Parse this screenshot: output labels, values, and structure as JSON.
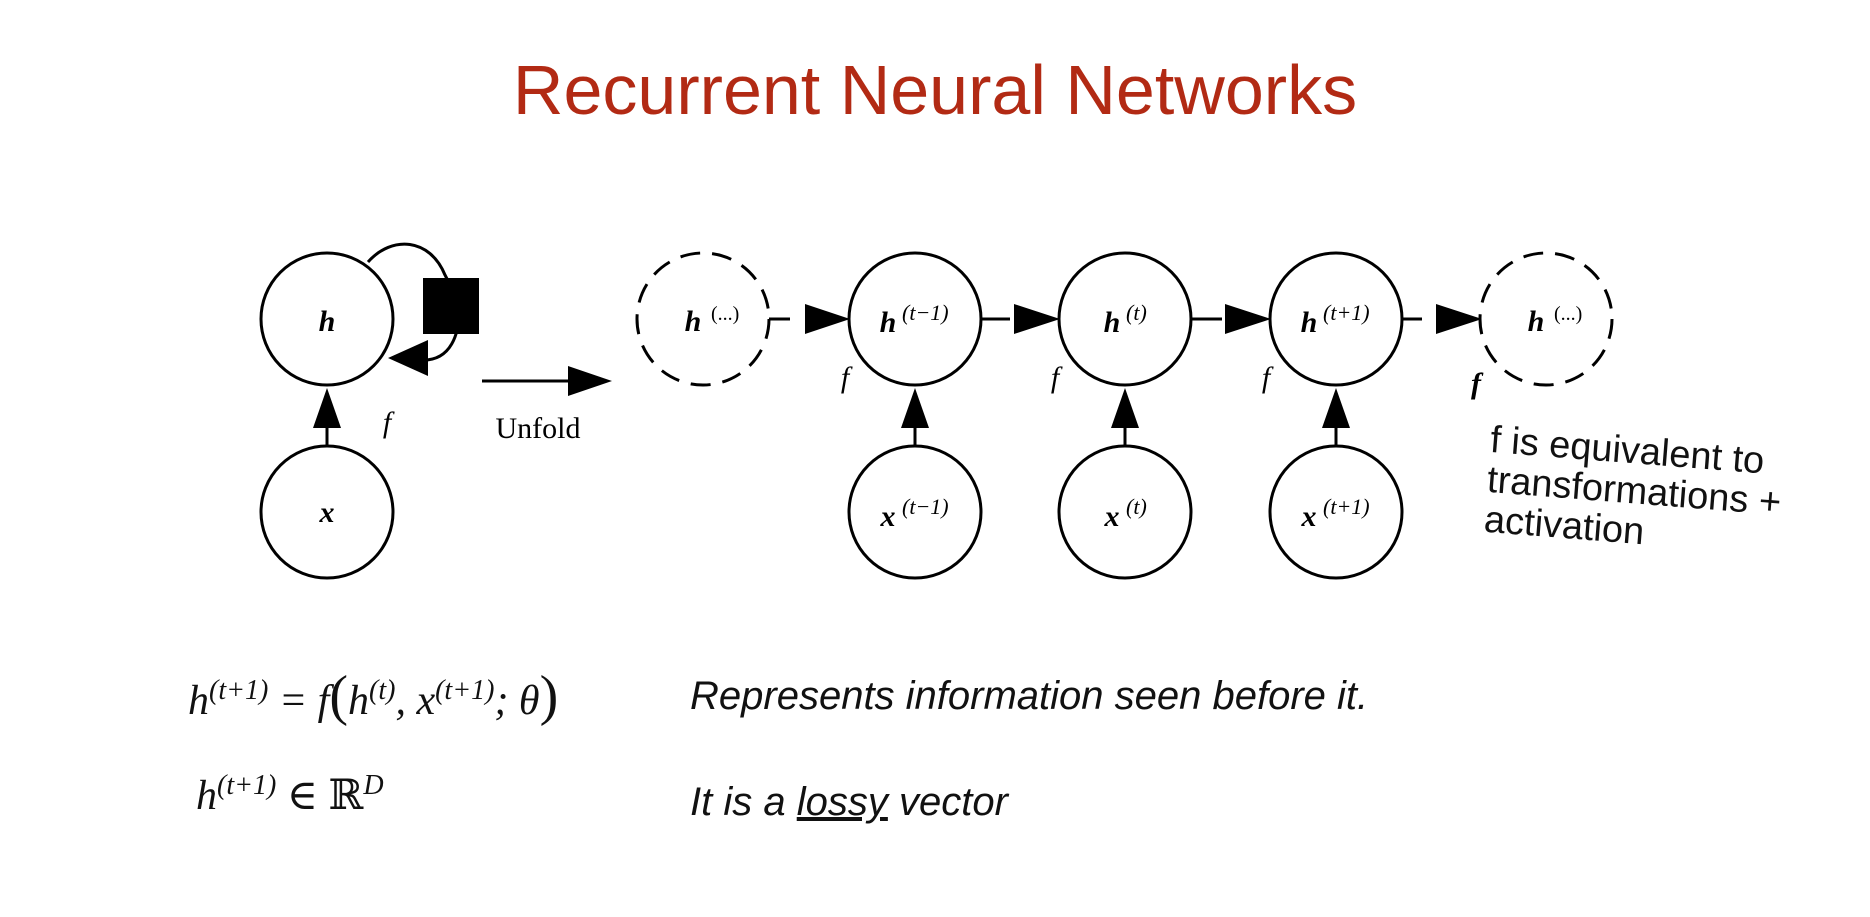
{
  "title": "Recurrent Neural Networks",
  "diagram": {
    "folded": {
      "h_node": "h",
      "x_node": "x",
      "f_label": "f"
    },
    "unfold_label": "Unfold",
    "unfolded": {
      "h_nodes": [
        {
          "base": "h",
          "sup": "(...)",
          "dashed": true
        },
        {
          "base": "h",
          "sup": "(t−1)",
          "dashed": false
        },
        {
          "base": "h",
          "sup": "(t)",
          "dashed": false
        },
        {
          "base": "h",
          "sup": "(t+1)",
          "dashed": false
        },
        {
          "base": "h",
          "sup": "(...)",
          "dashed": true
        }
      ],
      "x_nodes": [
        {
          "base": "x",
          "sup": "(t−1)"
        },
        {
          "base": "x",
          "sup": "(t)"
        },
        {
          "base": "x",
          "sup": "(t+1)"
        }
      ],
      "f_labels": [
        "f",
        "f",
        "f",
        "f"
      ]
    }
  },
  "note": {
    "lines": [
      "f is equivalent to",
      "transformations +",
      "activation"
    ]
  },
  "equations": {
    "eq1": {
      "lhs": "h",
      "lhs_sup": "(t+1)",
      "eq": "= f",
      "a": "h",
      "a_sup": "(t)",
      "b": "x",
      "b_sup": "(t+1)",
      "theta": "θ"
    },
    "eq2": {
      "lhs": "h",
      "lhs_sup": "(t+1)",
      "in": "∈",
      "set": "ℝ",
      "set_sup": "D"
    }
  },
  "descriptions": {
    "line1": "Represents information seen before it.",
    "line2_prefix": "It is a",
    "line2_underlined": "lossy",
    "line2_suffix": "vector"
  }
}
